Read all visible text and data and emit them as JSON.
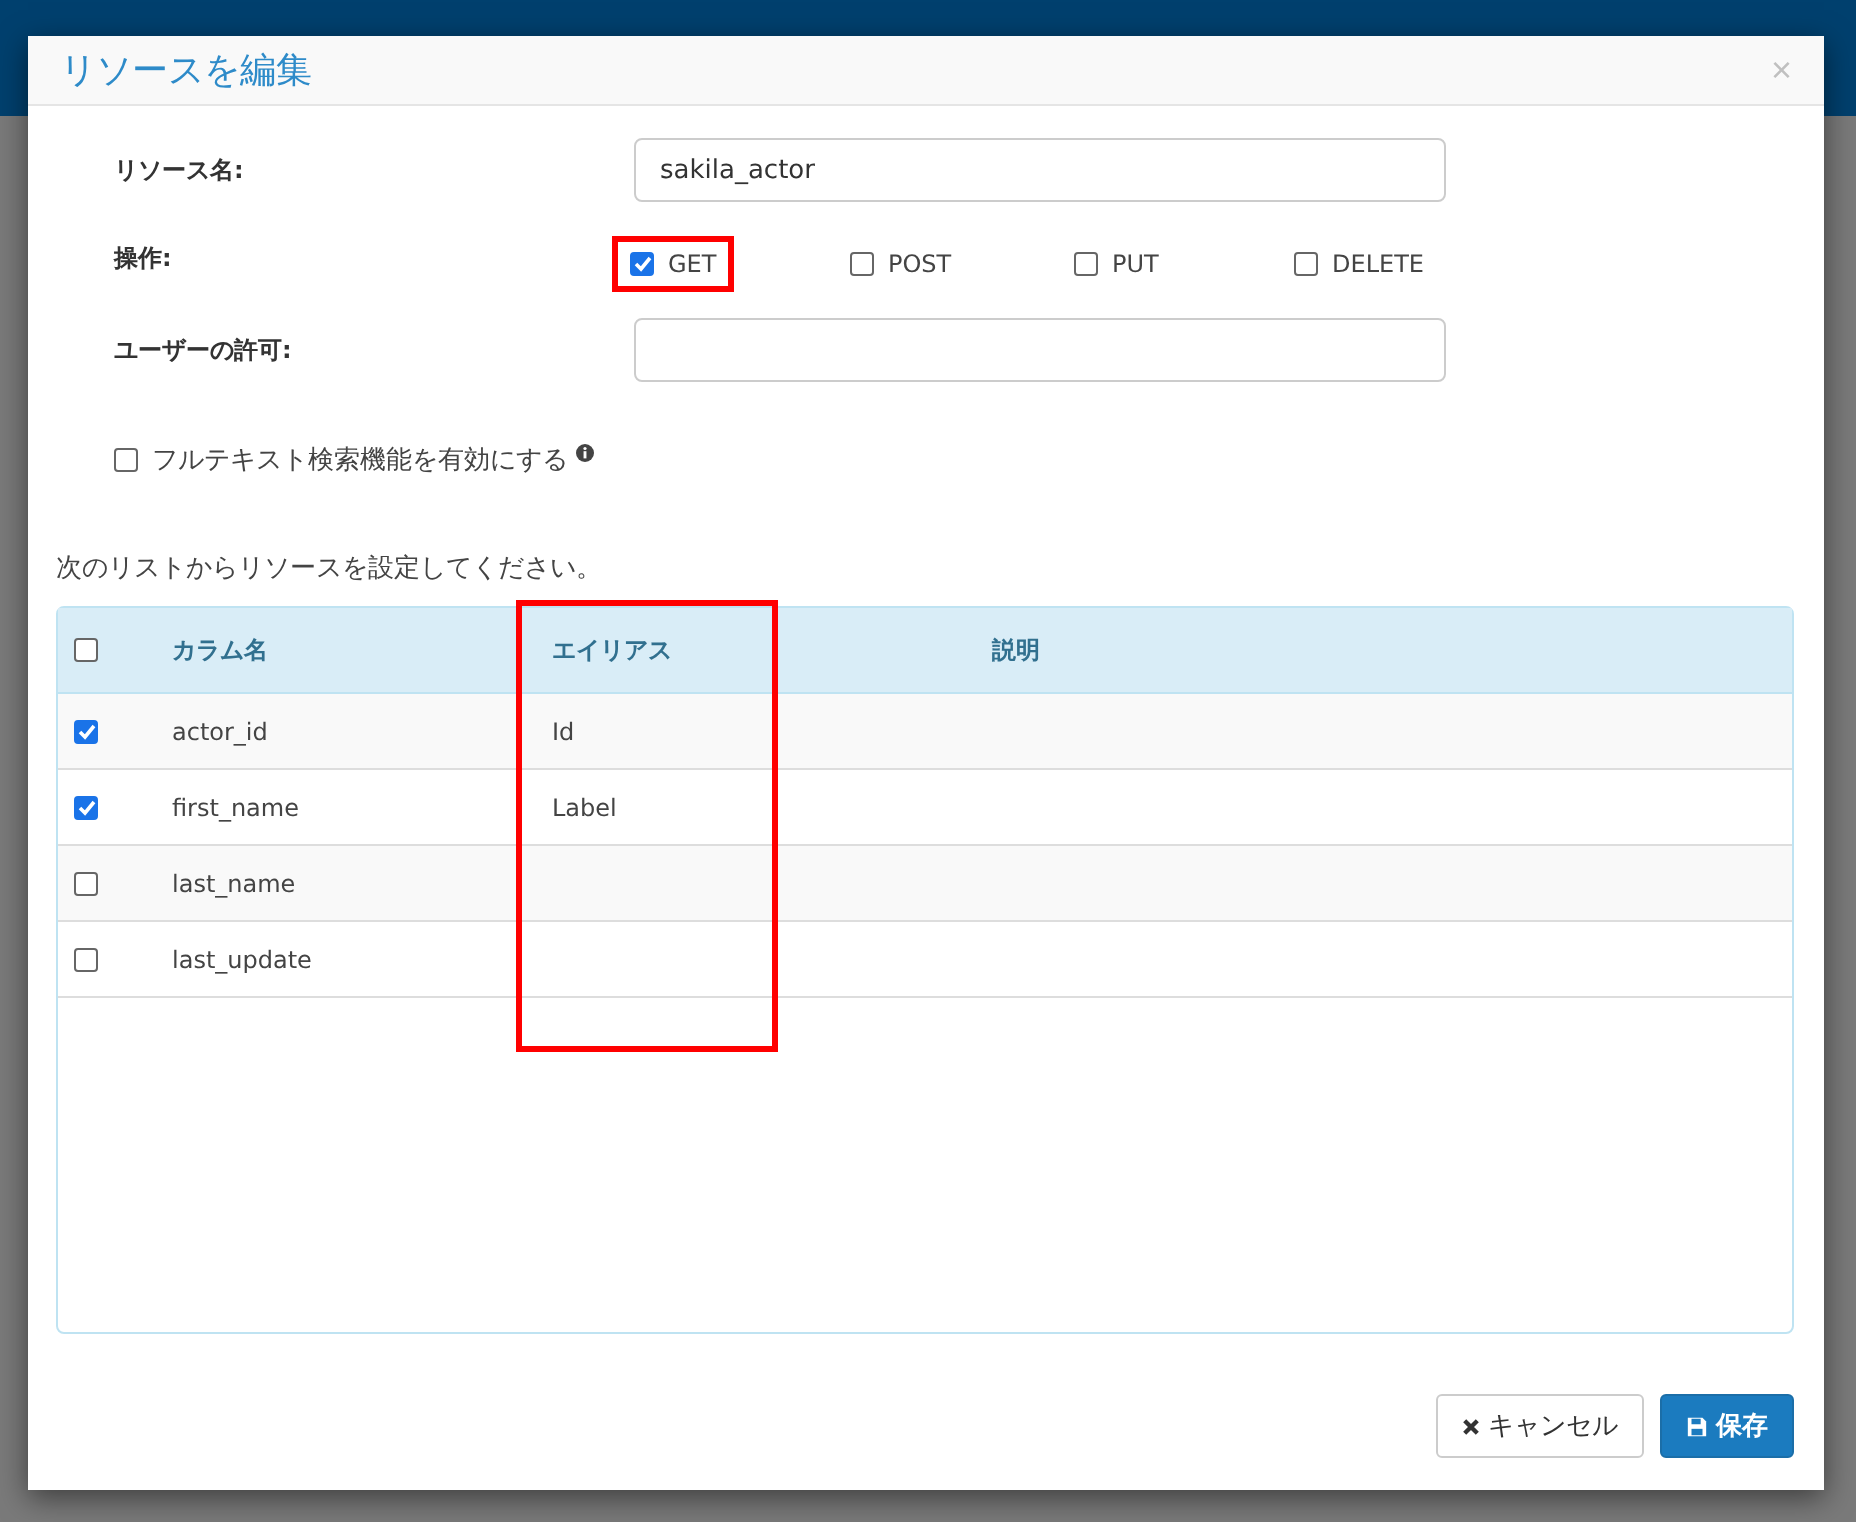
{
  "dialog": {
    "title": "リソースを編集",
    "close": "×"
  },
  "form": {
    "resource_name": {
      "label": "リソース名:",
      "value": "sakila_actor"
    },
    "operations_label": "操作:",
    "operations": [
      {
        "label": "GET",
        "checked": true,
        "highlighted": true
      },
      {
        "label": "POST",
        "checked": false,
        "highlighted": false
      },
      {
        "label": "PUT",
        "checked": false,
        "highlighted": false
      },
      {
        "label": "DELETE",
        "checked": false,
        "highlighted": false
      }
    ],
    "user_permission": {
      "label": "ユーザーの許可:"
    },
    "fulltext": {
      "label": "フルテキスト検索機能を有効にする",
      "checked": false
    }
  },
  "instruction": "次のリストからリソースを設定してください。",
  "table": {
    "select_all": false,
    "columns": [
      {
        "label": "カラム名",
        "highlighted": false
      },
      {
        "label": "エイリアス",
        "highlighted": true
      },
      {
        "label": "説明",
        "highlighted": false
      }
    ],
    "rows": [
      {
        "checked": true,
        "name": "actor_id",
        "alias": "Id"
      },
      {
        "checked": true,
        "name": "first_name",
        "alias": "Label"
      },
      {
        "checked": false,
        "name": "last_name"
      },
      {
        "checked": false,
        "name": "last_update"
      }
    ]
  },
  "buttons": [
    {
      "kind": "cancel",
      "label": "キャンセル"
    },
    {
      "kind": "save",
      "label": "保存"
    }
  ]
}
